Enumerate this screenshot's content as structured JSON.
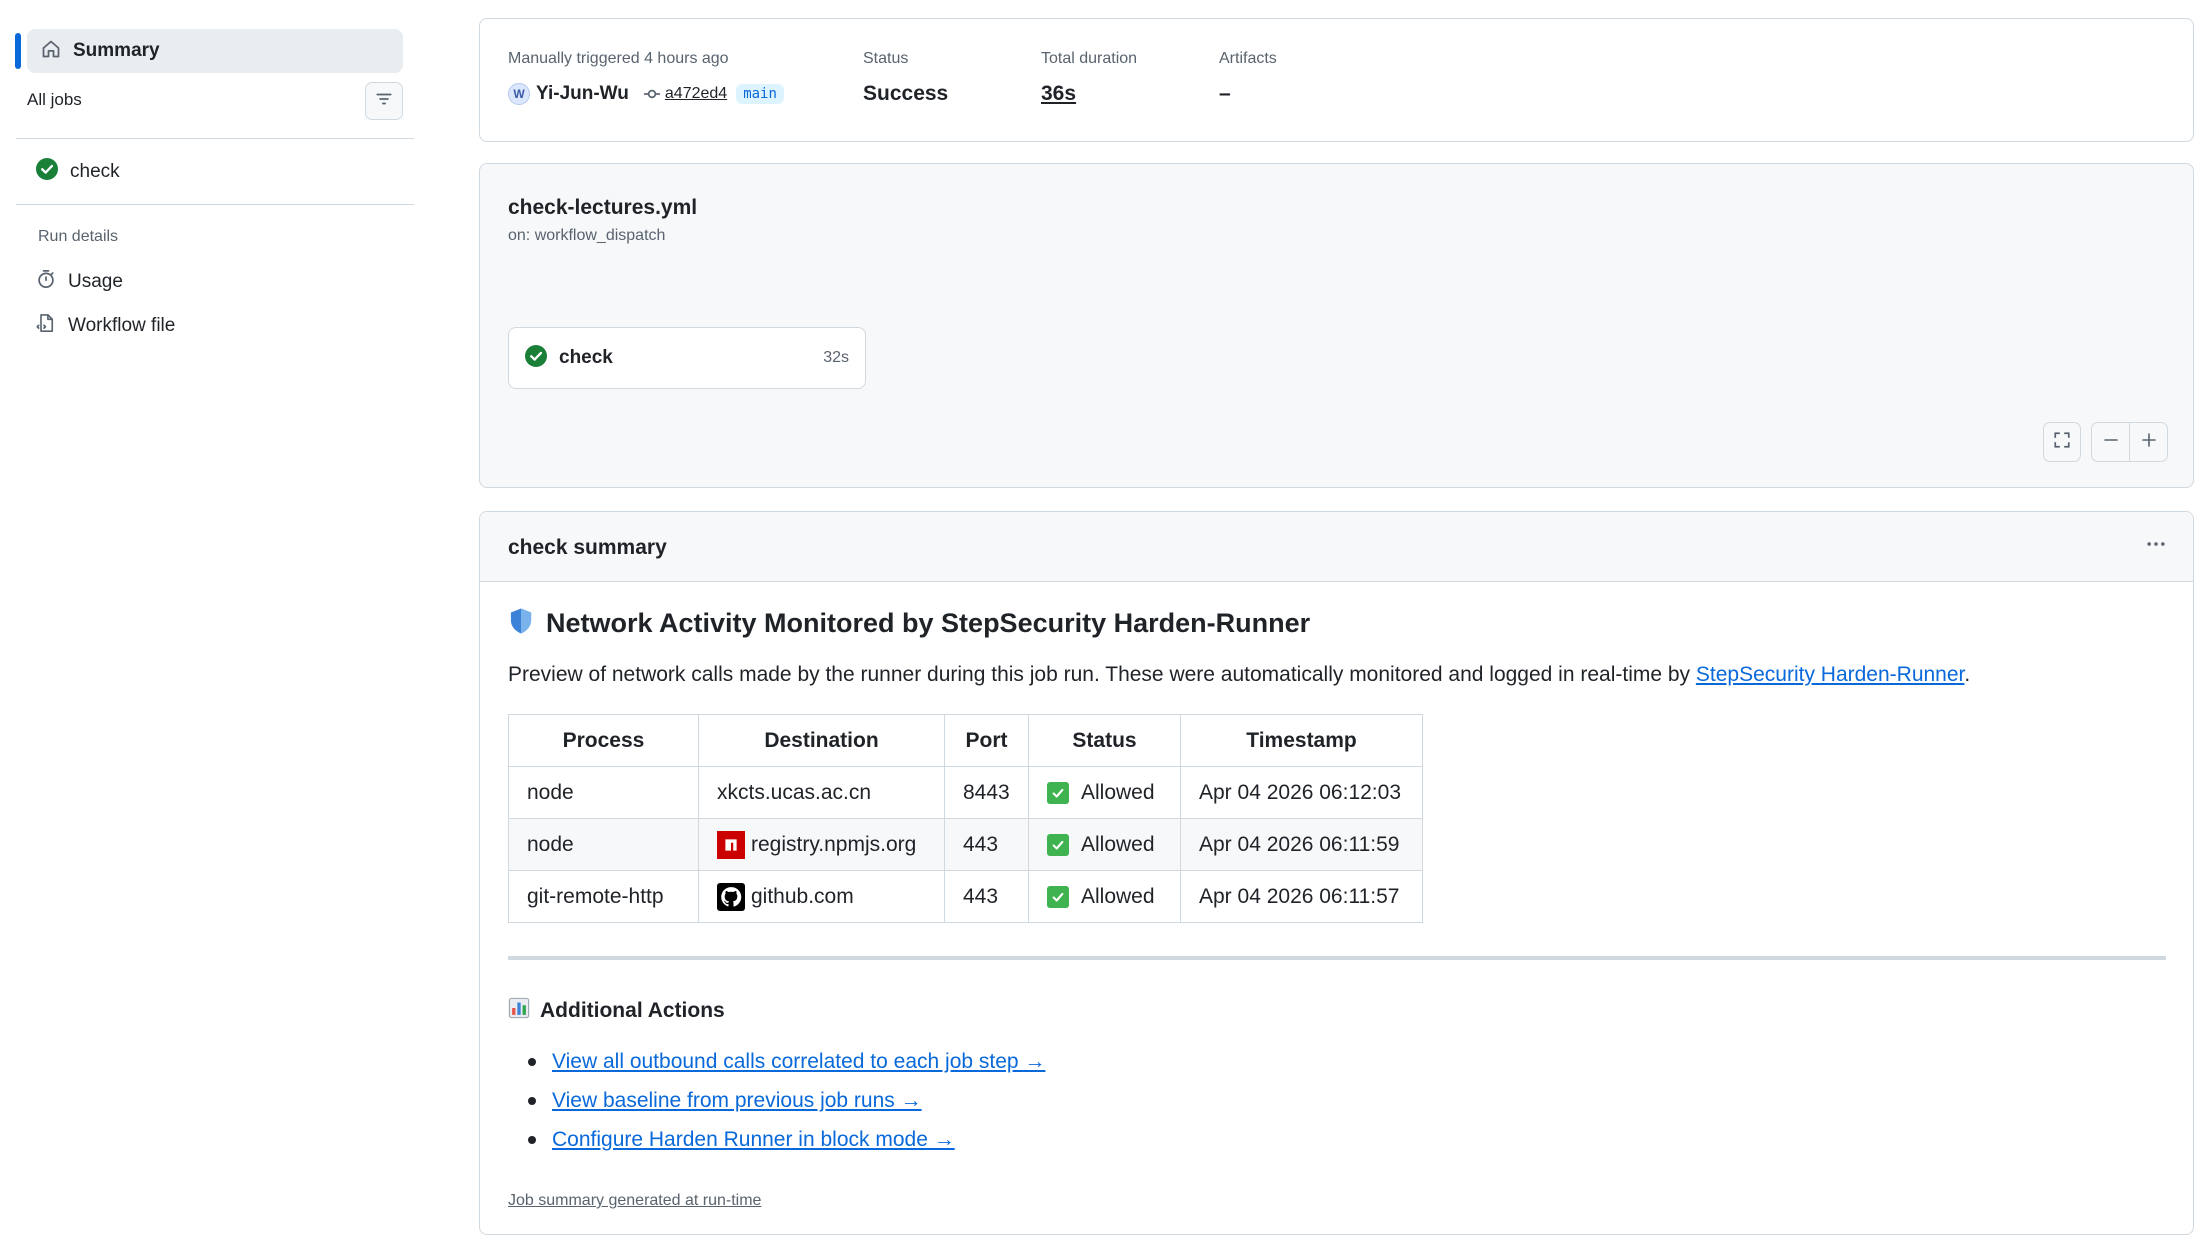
{
  "sidebar": {
    "summary_label": "Summary",
    "all_jobs_label": "All jobs",
    "jobs": [
      {
        "label": "check",
        "status": "success"
      }
    ],
    "run_details_label": "Run details",
    "links": [
      {
        "label": "Usage",
        "icon": "stopwatch-icon"
      },
      {
        "label": "Workflow file",
        "icon": "file-code-icon"
      }
    ]
  },
  "run_meta": {
    "trigger_text": "Manually triggered 4 hours ago",
    "actor": "Yi-Jun-Wu",
    "commit_sha": "a472ed4",
    "branch": "main",
    "status_label": "Status",
    "status_value": "Success",
    "duration_label": "Total duration",
    "duration_value": "36s",
    "artifacts_label": "Artifacts",
    "artifacts_value": "–"
  },
  "workflow": {
    "file_name": "check-lectures.yml",
    "trigger": "on: workflow_dispatch",
    "job": {
      "label": "check",
      "duration": "32s"
    }
  },
  "summary": {
    "title": "check summary",
    "heading": "Network Activity Monitored by StepSecurity Harden-Runner",
    "preview_text": "Preview of network calls made by the runner during this job run. These were automatically monitored and logged in real-time by ",
    "preview_link": "StepSecurity Harden-Runner",
    "preview_end": ".",
    "table": {
      "headers": [
        "Process",
        "Destination",
        "Port",
        "Status",
        "Timestamp"
      ],
      "rows": [
        {
          "process": "node",
          "destination": "xkcts.ucas.ac.cn",
          "dest_icon": "",
          "port": "8443",
          "status": "Allowed",
          "timestamp": "Apr 04 2026 06:12:03"
        },
        {
          "process": "node",
          "destination": "registry.npmjs.org",
          "dest_icon": "npm-icon",
          "port": "443",
          "status": "Allowed",
          "timestamp": "Apr 04 2026 06:11:59"
        },
        {
          "process": "git-remote-http",
          "destination": "github.com",
          "dest_icon": "github-icon",
          "port": "443",
          "status": "Allowed",
          "timestamp": "Apr 04 2026 06:11:57"
        }
      ]
    },
    "additional_actions_title": "Additional Actions",
    "links": [
      "View all outbound calls correlated to each job step →",
      "View baseline from previous job runs →",
      "Configure Harden Runner in block mode →"
    ],
    "footnote": "Job summary generated at run-time"
  },
  "colors": {
    "accent": "#0969da",
    "success": "#1a7f37",
    "allowed": "#3fb34f",
    "npm": "#cb0000"
  }
}
